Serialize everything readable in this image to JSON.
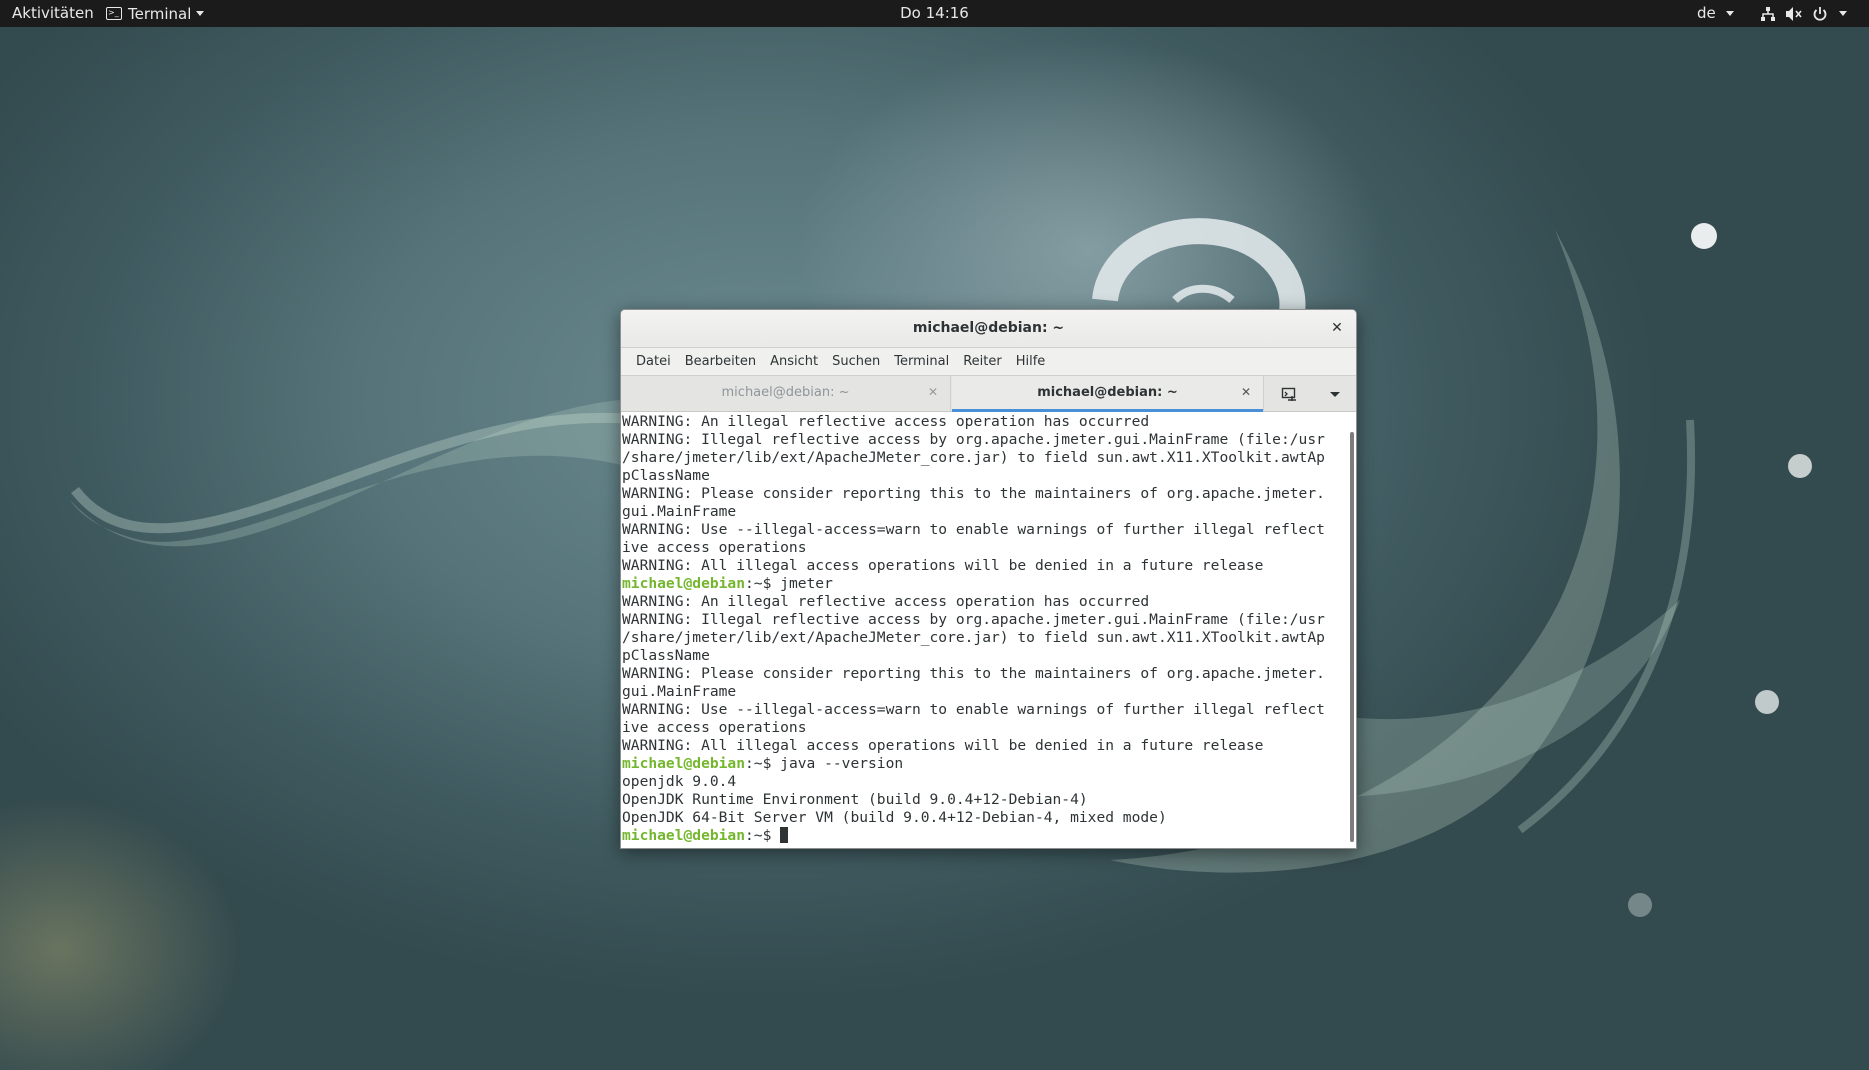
{
  "topbar": {
    "activities": "Aktivitäten",
    "app_menu": "Terminal",
    "clock": "Do 14:16",
    "keyboard_layout": "de",
    "tray_icons": [
      "network-icon",
      "volume-muted-icon",
      "power-icon",
      "chevron-down-icon"
    ]
  },
  "window": {
    "title": "michael@debian: ~",
    "menu": [
      "Datei",
      "Bearbeiten",
      "Ansicht",
      "Suchen",
      "Terminal",
      "Reiter",
      "Hilfe"
    ],
    "tabs": [
      {
        "label": "michael@debian: ~",
        "active": false
      },
      {
        "label": "michael@debian: ~",
        "active": true
      }
    ]
  },
  "terminal": {
    "prompt_user": "michael@debian",
    "prompt_suffix": ":~$",
    "lines": [
      {
        "text": "WARNING: An illegal reflective access operation has occurred"
      },
      {
        "text": "WARNING: Illegal reflective access by org.apache.jmeter.gui.MainFrame (file:/usr"
      },
      {
        "text": "/share/jmeter/lib/ext/ApacheJMeter_core.jar) to field sun.awt.X11.XToolkit.awtAp"
      },
      {
        "text": "pClassName"
      },
      {
        "text": "WARNING: Please consider reporting this to the maintainers of org.apache.jmeter."
      },
      {
        "text": "gui.MainFrame"
      },
      {
        "text": "WARNING: Use --illegal-access=warn to enable warnings of further illegal reflect"
      },
      {
        "text": "ive access operations"
      },
      {
        "text": "WARNING: All illegal access operations will be denied in a future release"
      },
      {
        "prompt": true,
        "command": " jmeter"
      },
      {
        "text": "WARNING: An illegal reflective access operation has occurred"
      },
      {
        "text": "WARNING: Illegal reflective access by org.apache.jmeter.gui.MainFrame (file:/usr"
      },
      {
        "text": "/share/jmeter/lib/ext/ApacheJMeter_core.jar) to field sun.awt.X11.XToolkit.awtAp"
      },
      {
        "text": "pClassName"
      },
      {
        "text": "WARNING: Please consider reporting this to the maintainers of org.apache.jmeter."
      },
      {
        "text": "gui.MainFrame"
      },
      {
        "text": "WARNING: Use --illegal-access=warn to enable warnings of further illegal reflect"
      },
      {
        "text": "ive access operations"
      },
      {
        "text": "WARNING: All illegal access operations will be denied in a future release"
      },
      {
        "prompt": true,
        "command": " java --version"
      },
      {
        "text": "openjdk 9.0.4"
      },
      {
        "text": "OpenJDK Runtime Environment (build 9.0.4+12-Debian-4)"
      },
      {
        "text": "OpenJDK 64-Bit Server VM (build 9.0.4+12-Debian-4, mixed mode)"
      },
      {
        "prompt": true,
        "command": "",
        "cursor": true
      }
    ]
  },
  "colors": {
    "topbar_bg": "#1b1b1b",
    "prompt_green": "#74b72e",
    "active_tab_accent": "#4a90d9",
    "terminal_fg": "#2e3436"
  }
}
